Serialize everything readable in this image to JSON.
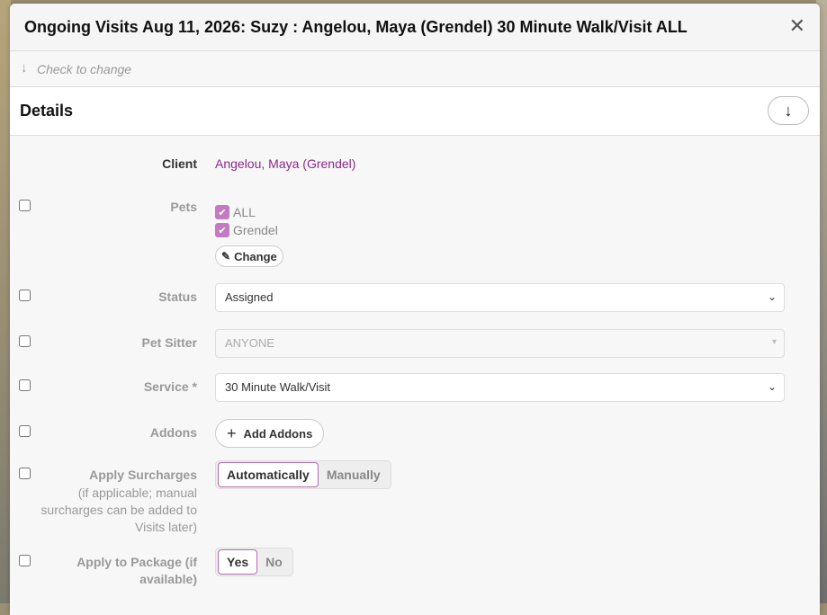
{
  "modal": {
    "title": "Ongoing Visits Aug 11, 2026: Suzy : Angelou, Maya (Grendel) 30 Minute Walk/Visit ALL",
    "close_icon": "close-icon"
  },
  "hint": {
    "text": "Check to change",
    "icon": "arrow-down-icon"
  },
  "section": {
    "label": "Details",
    "toggle_icon": "arrow-down-icon"
  },
  "fields": {
    "client": {
      "label": "Client",
      "value": "Angelou, Maya (Grendel)"
    },
    "pets": {
      "label": "Pets",
      "items": [
        {
          "label": "ALL",
          "checked": true
        },
        {
          "label": "Grendel",
          "checked": true
        }
      ],
      "change_label": "Change"
    },
    "status": {
      "label": "Status",
      "value": "Assigned"
    },
    "pet_sitter": {
      "label": "Pet Sitter",
      "value": "ANYONE"
    },
    "service": {
      "label": "Service *",
      "value": "30 Minute Walk/Visit"
    },
    "addons": {
      "label": "Addons",
      "button_label": "Add Addons"
    },
    "surcharges": {
      "label": "Apply Surcharges",
      "note": "(if applicable; manual surcharges can be added to Visits later)",
      "options": [
        "Automatically",
        "Manually"
      ],
      "selected": "Automatically"
    },
    "package": {
      "label_line1": "Apply to Package (if",
      "label_line2": "available)",
      "options": [
        "Yes",
        "No"
      ],
      "selected": "Yes"
    }
  },
  "colors": {
    "accent": "#8a2a8a",
    "checkbox": "#c27bc0",
    "active_border": "#b46bb0"
  }
}
